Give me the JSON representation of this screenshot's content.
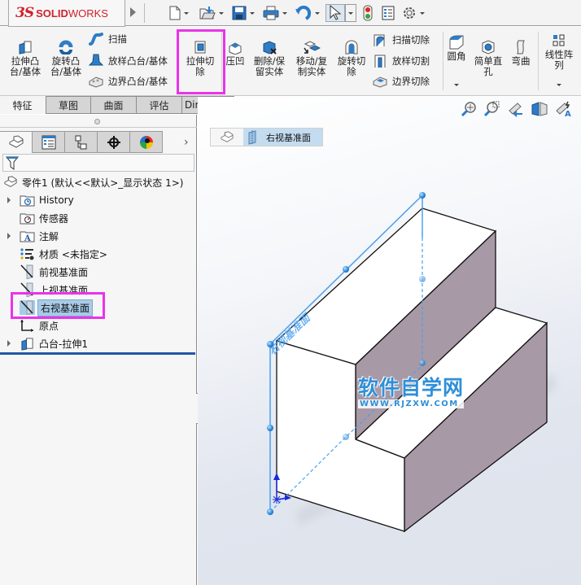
{
  "app": {
    "logo_prefix": "3S",
    "logo_bold": "SOLID",
    "logo_light": "WORKS"
  },
  "quick_access": [
    {
      "name": "new",
      "icon": "new-document-icon"
    },
    {
      "name": "open",
      "icon": "open-folder-icon"
    },
    {
      "name": "save",
      "icon": "save-icon"
    },
    {
      "name": "print",
      "icon": "print-icon"
    },
    {
      "name": "undo",
      "icon": "undo-icon"
    },
    {
      "name": "select",
      "icon": "select-pointer-icon"
    },
    {
      "name": "rebuild",
      "icon": "traffic-light-icon"
    },
    {
      "name": "file-properties",
      "icon": "file-properties-icon"
    },
    {
      "name": "options",
      "icon": "gear-icon"
    }
  ],
  "ribbon": {
    "extrude_boss": "拉伸凸\n台/基体",
    "revolve_boss": "旋转凸\n台/基体",
    "sweep": "扫描",
    "loft": "放样凸台/基体",
    "boundary": "边界凸台/基体",
    "extrude_cut": "拉伸切\n除",
    "indent": "压凹",
    "delete_keep_body": "删除/保\n留实体",
    "move_copy_body": "移动/复\n制实体",
    "revolve_cut": "旋转切\n除",
    "swept_cut": "扫描切除",
    "lofted_cut": "放样切割",
    "boundary_cut": "边界切除",
    "fillet": "圆角",
    "simple_hole": "简单直\n孔",
    "flex": "弯曲",
    "linear_pattern": "线性阵\n列"
  },
  "tabs": [
    {
      "label": "特征",
      "active": true
    },
    {
      "label": "草图",
      "active": false
    },
    {
      "label": "曲面",
      "active": false
    },
    {
      "label": "评估",
      "active": false
    },
    {
      "label": "DimXpert",
      "active": false
    }
  ],
  "panel_tabs": [
    {
      "name": "feature-manager",
      "icon": "feature-manager-icon",
      "active": true
    },
    {
      "name": "property-manager",
      "icon": "property-manager-icon",
      "active": false
    },
    {
      "name": "configuration-manager",
      "icon": "configuration-manager-icon",
      "active": false
    },
    {
      "name": "dimxpert-manager",
      "icon": "crosshair-icon",
      "active": false
    },
    {
      "name": "display-manager",
      "icon": "appearance-ball-icon",
      "active": false
    }
  ],
  "tree": {
    "root": "零件1  (默认<<默认>_显示状态 1>)",
    "items": [
      {
        "label": "History",
        "icon": "history-folder-icon",
        "expandable": true
      },
      {
        "label": "传感器",
        "icon": "sensor-folder-icon",
        "expandable": false
      },
      {
        "label": "注解",
        "icon": "annotations-folder-icon",
        "expandable": true
      },
      {
        "label": "材质 <未指定>",
        "icon": "material-icon",
        "expandable": false
      },
      {
        "label": "前视基准面",
        "icon": "plane-icon",
        "expandable": false
      },
      {
        "label": "上视基准面",
        "icon": "plane-icon",
        "expandable": false
      },
      {
        "label": "右视基准面",
        "icon": "plane-icon",
        "expandable": false,
        "selected": true
      },
      {
        "label": "原点",
        "icon": "origin-icon",
        "expandable": false
      },
      {
        "label": "凸台-拉伸1",
        "icon": "extrude-feature-icon",
        "expandable": true
      }
    ]
  },
  "view_toolbar": [
    {
      "name": "zoom-to-fit",
      "icon": "zoom-to-fit-icon"
    },
    {
      "name": "zoom-to-area",
      "icon": "zoom-area-icon"
    },
    {
      "name": "previous-view",
      "icon": "previous-view-icon"
    },
    {
      "name": "section-view",
      "icon": "section-view-icon"
    },
    {
      "name": "dynamic-annotation",
      "icon": "dynamic-annotation-icon"
    }
  ],
  "breadcrumb": {
    "selected": "右视基准面"
  },
  "viewport": {
    "plane_label": "右视基准面",
    "watermark_cn": "软件自学网",
    "watermark_url": "WWW.RJZXW.COM"
  },
  "colors": {
    "highlight": "#ea33ea",
    "plane_blue": "#4aa0ee",
    "face_side": "#a899a6",
    "brand_red": "#d0202a"
  }
}
